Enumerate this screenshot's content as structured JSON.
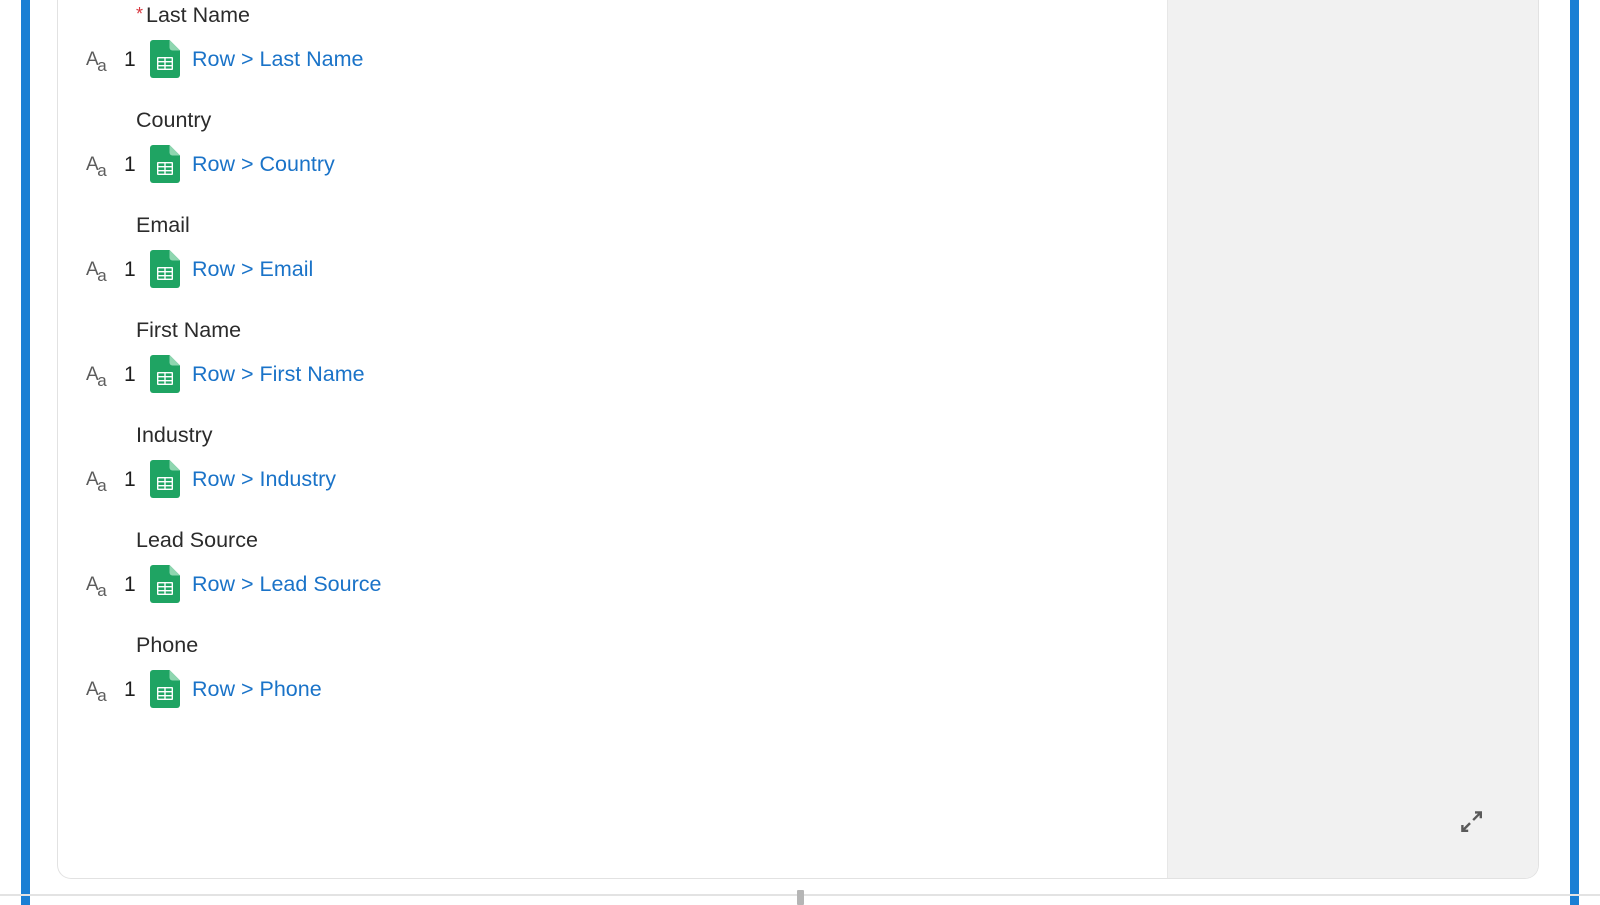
{
  "accent": {
    "rail_color": "#1a7fd4",
    "link_color": "#1a73c8",
    "required_color": "#d7373f",
    "sheets_green": "#1fa463",
    "panel_gray": "#f1f1f1"
  },
  "mapping_panel": {
    "type_icon_label": "Aa",
    "fields": [
      {
        "label": "Last Name",
        "required": true,
        "required_marker": "*",
        "type_icon_upper": "A",
        "type_icon_lower": "a",
        "count": "1",
        "source_icon": "google-sheets-icon",
        "mapping": "Row > Last Name"
      },
      {
        "label": "Country",
        "required": false,
        "required_marker": "",
        "type_icon_upper": "A",
        "type_icon_lower": "a",
        "count": "1",
        "source_icon": "google-sheets-icon",
        "mapping": "Row > Country"
      },
      {
        "label": "Email",
        "required": false,
        "required_marker": "",
        "type_icon_upper": "A",
        "type_icon_lower": "a",
        "count": "1",
        "source_icon": "google-sheets-icon",
        "mapping": "Row > Email"
      },
      {
        "label": "First Name",
        "required": false,
        "required_marker": "",
        "type_icon_upper": "A",
        "type_icon_lower": "a",
        "count": "1",
        "source_icon": "google-sheets-icon",
        "mapping": "Row > First Name"
      },
      {
        "label": "Industry",
        "required": false,
        "required_marker": "",
        "type_icon_upper": "A",
        "type_icon_lower": "a",
        "count": "1",
        "source_icon": "google-sheets-icon",
        "mapping": "Row > Industry"
      },
      {
        "label": "Lead Source",
        "required": false,
        "required_marker": "",
        "type_icon_upper": "A",
        "type_icon_lower": "a",
        "count": "1",
        "source_icon": "google-sheets-icon",
        "mapping": "Row > Lead Source"
      },
      {
        "label": "Phone",
        "required": false,
        "required_marker": "",
        "type_icon_upper": "A",
        "type_icon_lower": "a",
        "count": "1",
        "source_icon": "google-sheets-icon",
        "mapping": "Row > Phone"
      }
    ]
  },
  "side_pane": {
    "expand_icon": "expand-diagonal-icon"
  }
}
